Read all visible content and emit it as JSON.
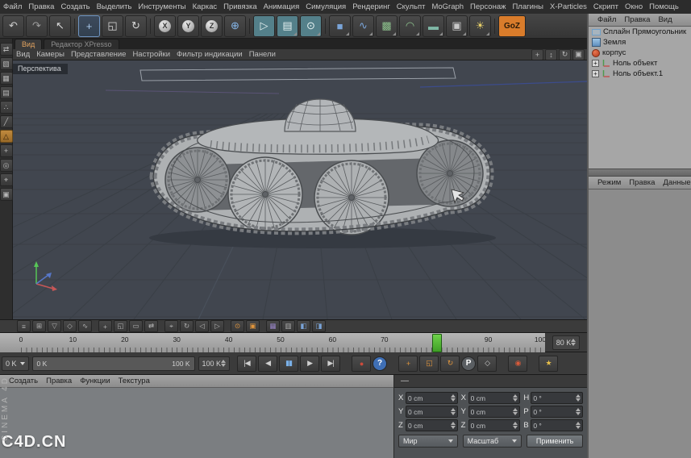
{
  "colors": {
    "accent_orange": "#d97c2b",
    "marker_green": "#55c32f",
    "record_red": "#cc4b3b",
    "play_blue": "#7ab0e8",
    "viewport_bg": "#41464f"
  },
  "menubar": {
    "items": [
      "Файл",
      "Правка",
      "Создать",
      "Выделить",
      "Инструменты",
      "Каркас",
      "Привязка",
      "Анимация",
      "Симуляция",
      "Рендеринг",
      "Скульпт",
      "MoGraph",
      "Персонаж",
      "Плагины",
      "X-Particles",
      "Скрипт",
      "Окно",
      "Помощь"
    ]
  },
  "toolbar": {
    "icons": [
      {
        "name": "undo-icon",
        "glyph": "↶",
        "color": "#cfcfcf"
      },
      {
        "name": "redo-icon",
        "glyph": "↷",
        "color": "#9f9f9f"
      },
      {
        "name": "live-selection-icon",
        "glyph": "↖",
        "color": "#d8d8d8"
      },
      {
        "sep": true
      },
      {
        "name": "move-tool-icon",
        "glyph": "+",
        "color": "#a8c8ea",
        "active": true
      },
      {
        "name": "scale-tool-icon",
        "glyph": "◱",
        "color": "#d8d8d8"
      },
      {
        "name": "rotate-tool-icon",
        "glyph": "↻",
        "color": "#d8d8d8"
      },
      {
        "sep": true
      },
      {
        "name": "lock-x-axis-icon",
        "letter": "X"
      },
      {
        "name": "lock-y-axis-icon",
        "letter": "Y"
      },
      {
        "name": "lock-z-axis-icon",
        "letter": "Z"
      },
      {
        "name": "coordinate-system-icon",
        "glyph": "⊕",
        "color": "#86b7ea"
      },
      {
        "sep": true
      },
      {
        "name": "render-view-icon",
        "glyph": "▷",
        "color": "#e6f2f2",
        "bg": "#54808a"
      },
      {
        "name": "render-picture-viewer-icon",
        "glyph": "▤",
        "color": "#e6f2f2",
        "bg": "#54808a",
        "corner": true
      },
      {
        "name": "render-settings-icon",
        "glyph": "⊙",
        "color": "#e6f2f2",
        "bg": "#54808a",
        "corner": true
      },
      {
        "sep": true
      },
      {
        "name": "add-cube-icon",
        "glyph": "■",
        "color": "#7aa4d8",
        "corner": true
      },
      {
        "name": "spline-pen-icon",
        "glyph": "∿",
        "color": "#7aa4d8",
        "corner": true
      },
      {
        "name": "subdivision-surface-icon",
        "glyph": "▩",
        "color": "#8cc08c",
        "corner": true
      },
      {
        "name": "deformer-icon",
        "glyph": "◠",
        "color": "#8cc08c",
        "corner": true
      },
      {
        "name": "environment-icon",
        "glyph": "▬",
        "color": "#7fb7a6",
        "corner": true
      },
      {
        "name": "camera-icon",
        "glyph": "▣",
        "color": "#c8c8c8",
        "corner": true
      },
      {
        "name": "light-icon",
        "glyph": "☀",
        "color": "#e8d06a",
        "corner": true
      },
      {
        "sep": true
      },
      {
        "name": "goz-button",
        "label": "GoZ",
        "bg": "#d97c2b",
        "color": "#2a1a08"
      }
    ]
  },
  "left_toolbar": {
    "icons": [
      {
        "name": "make-editable-icon",
        "glyph": "⇄"
      },
      {
        "name": "model-mode-icon",
        "glyph": "▧"
      },
      {
        "name": "texture-mode-icon",
        "glyph": "▦"
      },
      {
        "name": "workplane-mode-icon",
        "glyph": "▤"
      },
      {
        "name": "points-mode-icon",
        "glyph": "∴"
      },
      {
        "name": "edges-mode-icon",
        "glyph": "╱"
      },
      {
        "name": "polygons-mode-icon",
        "glyph": "△",
        "active": true
      },
      {
        "name": "axis-mode-icon",
        "glyph": "+"
      },
      {
        "name": "viewport-solo-icon",
        "glyph": "◎"
      },
      {
        "name": "snap-toggle-icon",
        "glyph": "⌖"
      },
      {
        "name": "workplane-lock-icon",
        "glyph": "▣"
      }
    ]
  },
  "viewport": {
    "tabs": [
      {
        "label": "Вид",
        "active": true
      },
      {
        "label": "Редактор XPresso",
        "active": false
      }
    ],
    "menu": [
      "Вид",
      "Камеры",
      "Представление",
      "Настройки",
      "Фильтр индикации",
      "Панели"
    ],
    "nav_icons": [
      {
        "name": "pan-view-icon",
        "glyph": "+"
      },
      {
        "name": "zoom-view-icon",
        "glyph": "↕"
      },
      {
        "name": "rotate-view-icon",
        "glyph": "↻"
      },
      {
        "name": "toggle-layout-icon",
        "glyph": "▣"
      }
    ],
    "view_label": "Перспектива"
  },
  "object_manager": {
    "menu": [
      "Файл",
      "Правка",
      "Вид"
    ],
    "objects": [
      {
        "name": "object-spline-rectangle",
        "icon": "spline-rectangle-icon",
        "label": "Сплайн Прямоугольник",
        "expander": false
      },
      {
        "name": "object-earth",
        "icon": "earth-icon",
        "label": "Земля",
        "expander": false
      },
      {
        "name": "object-korpus",
        "icon": "body-sphere-icon",
        "label": "корпус",
        "expander": false
      },
      {
        "name": "object-null",
        "icon": "null-object-icon",
        "label": "Ноль объект",
        "expander": true
      },
      {
        "name": "object-null-1",
        "icon": "null-object-icon",
        "label": "Ноль объект.1",
        "expander": true
      }
    ]
  },
  "attribute_manager": {
    "menu": [
      "Режим",
      "Правка",
      "Данные"
    ]
  },
  "timeline_toolbar": {
    "icons": [
      {
        "name": "summary-track-icon",
        "glyph": "≡"
      },
      {
        "name": "hierarchy-icon",
        "glyph": "⊞"
      },
      {
        "name": "marker-icon",
        "glyph": "▽"
      },
      {
        "name": "key-mode-icon",
        "glyph": "◇"
      },
      {
        "name": "fcurve-mode-icon",
        "glyph": "∿"
      },
      {
        "sep": true
      },
      {
        "name": "move-keys-icon",
        "glyph": "+"
      },
      {
        "name": "scale-keys-icon",
        "glyph": "◱"
      },
      {
        "name": "region-tool-icon",
        "glyph": "▭"
      },
      {
        "name": "ripple-edit-icon",
        "glyph": "⇄"
      },
      {
        "sep": true
      },
      {
        "name": "snap-keys-icon",
        "glyph": "⌖"
      },
      {
        "name": "loop-icon",
        "glyph": "↻"
      },
      {
        "name": "track-before-icon",
        "glyph": "◁"
      },
      {
        "name": "track-after-icon",
        "glyph": "▷"
      },
      {
        "sep": true
      },
      {
        "name": "link-selection-icon",
        "glyph": "⊙",
        "accent": "#e0953c"
      },
      {
        "name": "auto-mode-icon",
        "glyph": "▣",
        "accent": "#e0953c"
      },
      {
        "sep": true
      },
      {
        "name": "xpresso-icon",
        "glyph": "▦",
        "accent": "#9a86c8"
      },
      {
        "name": "sound-track-icon",
        "glyph": "▥"
      },
      {
        "name": "layer-a-icon",
        "glyph": "◧",
        "accent": "#7aa4d8"
      },
      {
        "name": "layer-b-icon",
        "glyph": "◨",
        "accent": "#7aa4d8"
      }
    ]
  },
  "timeline": {
    "ticks": [
      "0",
      "10",
      "20",
      "30",
      "40",
      "50",
      "60",
      "70",
      "80",
      "90",
      "100"
    ],
    "marker_frame": 80,
    "frame_field": "80 K"
  },
  "transport": {
    "start_field": "0 K",
    "range_start": "0 K",
    "range_end": "100 K",
    "end_field": "100 K",
    "buttons": [
      {
        "name": "goto-start-button",
        "glyph": "|◀"
      },
      {
        "name": "previous-frame-button",
        "glyph": "◀"
      },
      {
        "name": "play-button",
        "glyph": "▮▮",
        "color": "#7ab0e8"
      },
      {
        "name": "next-frame-button",
        "glyph": "▶"
      },
      {
        "name": "goto-end-button",
        "glyph": "▶|"
      },
      {
        "gap": true,
        "name": "record-keyframe-button",
        "glyph": "●",
        "color": "#cc4b3b"
      },
      {
        "name": "help-button",
        "circle": "?",
        "bg": "#3f6fb5"
      },
      {
        "gap": true,
        "name": "record-position-button",
        "glyph": "+",
        "color": "#e0953c"
      },
      {
        "name": "record-scale-button",
        "glyph": "◱",
        "color": "#e0953c"
      },
      {
        "name": "record-rotation-button",
        "glyph": "↻",
        "color": "#e0953c"
      },
      {
        "name": "record-parameter-button",
        "circle": "P",
        "bg": "#5a5e62"
      },
      {
        "name": "record-pla-button",
        "glyph": "◇",
        "color": "#c8c8c8"
      },
      {
        "gap": true,
        "name": "autokey-button",
        "glyph": "◉",
        "color": "#d85a3a"
      },
      {
        "gap": true,
        "name": "keyframe-selection-button",
        "glyph": "★",
        "color": "#e8c04a"
      }
    ]
  },
  "materials": {
    "menu": [
      "Создать",
      "Правка",
      "Функции",
      "Текстура"
    ]
  },
  "coordinates": {
    "title": "—",
    "groups": [
      {
        "rows": [
          {
            "label": "X",
            "value": "0 cm"
          },
          {
            "label": "Y",
            "value": "0 cm"
          },
          {
            "label": "Z",
            "value": "0 cm"
          }
        ]
      },
      {
        "rows": [
          {
            "label": "X",
            "value": "0 cm"
          },
          {
            "label": "Y",
            "value": "0 cm"
          },
          {
            "label": "Z",
            "value": "0 cm"
          }
        ]
      },
      {
        "rows": [
          {
            "label": "H",
            "value": "0 °"
          },
          {
            "label": "P",
            "value": "0 °"
          },
          {
            "label": "B",
            "value": "0 °"
          }
        ]
      }
    ],
    "space_dropdown": "Мир",
    "scale_dropdown": "Масштаб",
    "apply_button": "Применить"
  },
  "watermark": {
    "text": "C4D.CN"
  },
  "brand": {
    "vertical": "CINEMA 4D"
  }
}
